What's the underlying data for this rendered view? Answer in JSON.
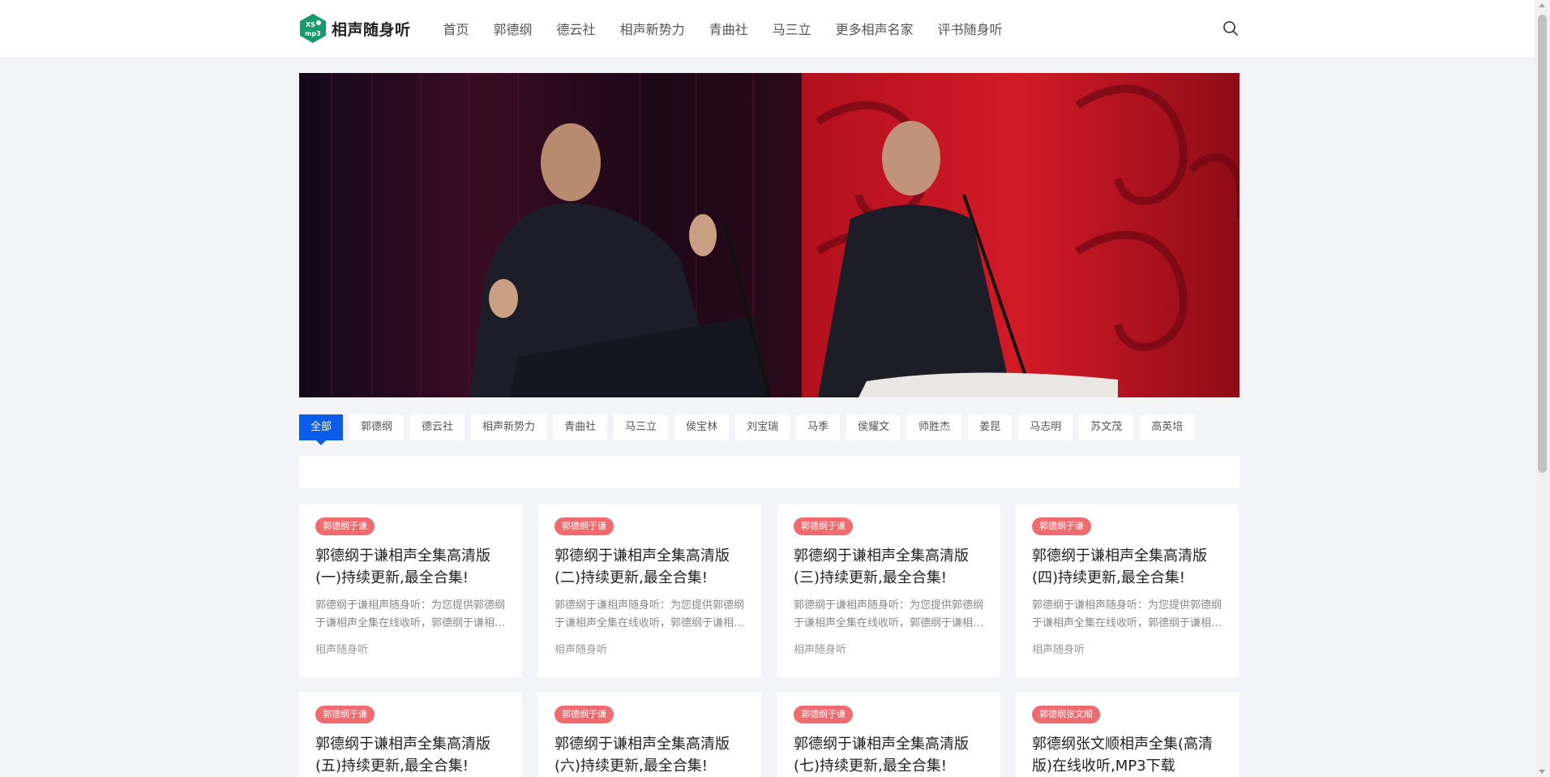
{
  "header": {
    "logo_mark_text": "XS mp3",
    "logo_text": "相声随身听",
    "nav": [
      "首页",
      "郭德纲",
      "德云社",
      "相声新势力",
      "青曲社",
      "马三立",
      "更多相声名家",
      "评书随身听"
    ]
  },
  "tabs": [
    "全部",
    "郭德纲",
    "德云社",
    "相声新势力",
    "青曲社",
    "马三立",
    "侯宝林",
    "刘宝瑞",
    "马季",
    "侯耀文",
    "师胜杰",
    "姜昆",
    "马志明",
    "苏文茂",
    "高英培"
  ],
  "cards": [
    {
      "badge": "郭德纲于谦",
      "title": "郭德纲于谦相声全集高清版(一)持续更新,最全合集!",
      "excerpt": "郭德纲于谦相声随身听：为您提供郭德纲于谦相声全集在线收听，郭德纲于谦相声全集高清版",
      "author": "相声随身听"
    },
    {
      "badge": "郭德纲于谦",
      "title": "郭德纲于谦相声全集高清版(二)持续更新,最全合集!",
      "excerpt": "郭德纲于谦相声随身听：为您提供郭德纲于谦相声全集在线收听，郭德纲于谦相声全集高清版",
      "author": "相声随身听"
    },
    {
      "badge": "郭德纲于谦",
      "title": "郭德纲于谦相声全集高清版(三)持续更新,最全合集!",
      "excerpt": "郭德纲于谦相声随身听：为您提供郭德纲于谦相声全集在线收听，郭德纲于谦相声全集高清版",
      "author": "相声随身听"
    },
    {
      "badge": "郭德纲于谦",
      "title": "郭德纲于谦相声全集高清版(四)持续更新,最全合集!",
      "excerpt": "郭德纲于谦相声随身听：为您提供郭德纲于谦相声全集在线收听，郭德纲于谦相声全集高清版",
      "author": "相声随身听"
    },
    {
      "badge": "郭德纲于谦",
      "title": "郭德纲于谦相声全集高清版(五)持续更新,最全合集!",
      "excerpt": "",
      "author": ""
    },
    {
      "badge": "郭德纲于谦",
      "title": "郭德纲于谦相声全集高清版(六)持续更新,最全合集!",
      "excerpt": "",
      "author": ""
    },
    {
      "badge": "郭德纲于谦",
      "title": "郭德纲于谦相声全集高清版(七)持续更新,最全合集!",
      "excerpt": "",
      "author": ""
    },
    {
      "badge": "郭德纲张文顺",
      "title": "郭德纲张文顺相声全集(高清版)在线收听,MP3下载",
      "excerpt": "",
      "author": ""
    }
  ],
  "colors": {
    "accent": "#0a5ce9",
    "badge": "#f06b6e",
    "logo": "#1a9a6c"
  },
  "icons": {
    "search": "search-icon",
    "logo": "logo-hexagon-icon"
  }
}
